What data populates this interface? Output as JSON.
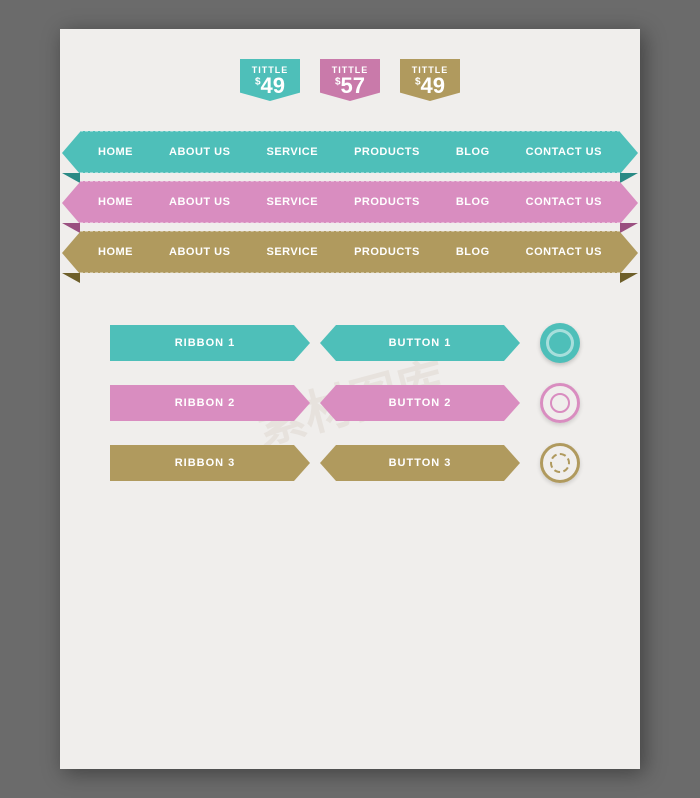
{
  "priceTags": [
    {
      "title": "TITTLE",
      "price": "49",
      "color": "teal"
    },
    {
      "title": "TITTLE",
      "price": "57",
      "color": "pink"
    },
    {
      "title": "TITTLE",
      "price": "49",
      "color": "gold"
    }
  ],
  "navBars": [
    {
      "color": "teal",
      "items": [
        "HOME",
        "ABOUT US",
        "SERVICE",
        "PRODUCTS",
        "BLOG",
        "CONTACT US"
      ]
    },
    {
      "color": "pink",
      "items": [
        "HOME",
        "ABOUT US",
        "SERVICE",
        "PRODUCTS",
        "BLOG",
        "CONTACT US"
      ]
    },
    {
      "color": "gold",
      "items": [
        "HOME",
        "ABOUT US",
        "SERVICE",
        "PRODUCTS",
        "BLOG",
        "CONTACT US"
      ]
    }
  ],
  "ribbons": [
    {
      "label": "RIBBON 1",
      "color": "teal"
    },
    {
      "label": "RIBBON 2",
      "color": "pink"
    },
    {
      "label": "RIBBON 3",
      "color": "gold"
    }
  ],
  "buttons": [
    {
      "label": "BUTTON 1",
      "color": "teal"
    },
    {
      "label": "BUTTON 2",
      "color": "pink"
    },
    {
      "label": "BUTTON 3",
      "color": "gold"
    }
  ]
}
